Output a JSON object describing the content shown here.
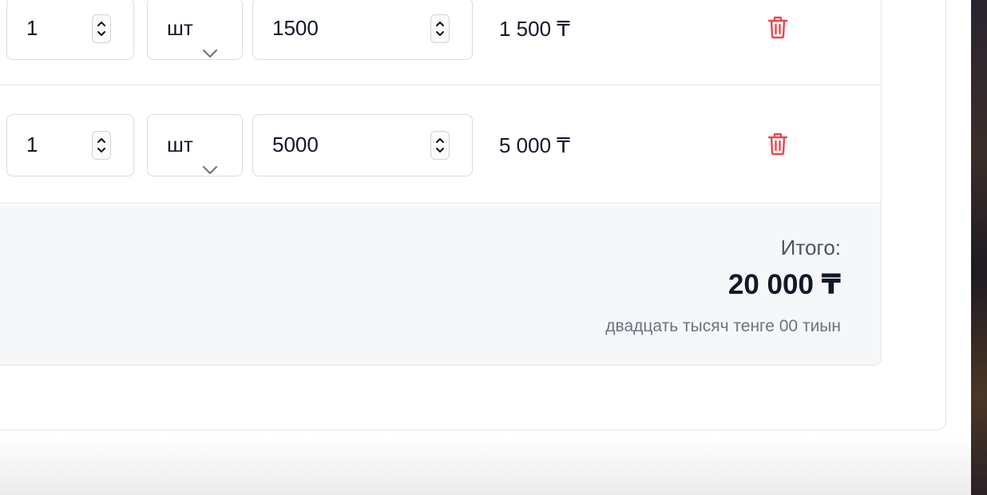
{
  "rows": [
    {
      "quantity": "1",
      "unit": "шт",
      "price": "1500",
      "amount": "1 500 ₸"
    },
    {
      "quantity": "1",
      "unit": "шт",
      "price": "5000",
      "amount": "5 000 ₸"
    }
  ],
  "summary": {
    "label": "Итого:",
    "total": "20 000 ₸",
    "total_in_words": "двадцать тысяч тенге 00 тиын"
  },
  "icons": {
    "delete": "trash-icon",
    "stepper": "stepper-icon",
    "dropdown": "chevron-down-icon"
  },
  "colors": {
    "delete": "#e5484d",
    "border": "#d9dce1",
    "footer_bg": "#f6f7f9"
  }
}
